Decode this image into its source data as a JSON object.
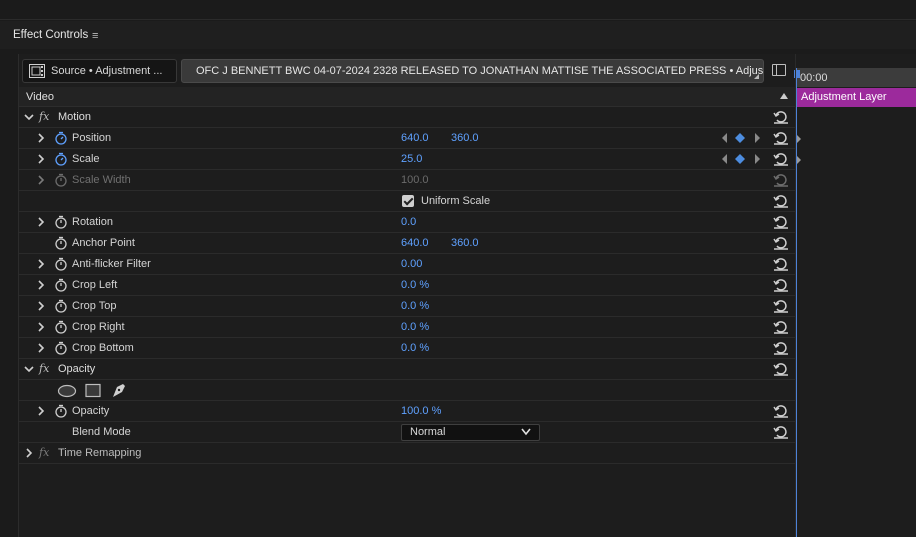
{
  "panel": {
    "title": "Effect Controls",
    "menu_glyph": "≡"
  },
  "source": {
    "label": "Source • Adjustment ...",
    "icon": "film-icon"
  },
  "sequence": {
    "label": "OFC J BENNETT BWC  04-07-2024 2328 RELEASED TO JONATHAN MATTISE THE ASSOCIATED PRESS • Adjus...",
    "icon": "sequence-icon"
  },
  "timeline": {
    "timecode": "00:00",
    "clip_label": "Adjustment Layer",
    "clip_color": "#9c2a9c",
    "playhead_color": "#4d82d8"
  },
  "video_header": "Video",
  "motion": {
    "label": "Motion",
    "fx": "fx",
    "position": {
      "label": "Position",
      "x": "640.0",
      "y": "360.0"
    },
    "scale": {
      "label": "Scale",
      "value": "25.0"
    },
    "scale_width": {
      "label": "Scale Width",
      "value": "100.0"
    },
    "uniform_scale": {
      "label": "Uniform Scale",
      "checked": true
    },
    "rotation": {
      "label": "Rotation",
      "value": "0.0"
    },
    "anchor_point": {
      "label": "Anchor Point",
      "x": "640.0",
      "y": "360.0"
    },
    "anti_flicker": {
      "label": "Anti-flicker Filter",
      "value": "0.00"
    },
    "crop_left": {
      "label": "Crop Left",
      "value": "0.0 %"
    },
    "crop_top": {
      "label": "Crop Top",
      "value": "0.0 %"
    },
    "crop_right": {
      "label": "Crop Right",
      "value": "0.0 %"
    },
    "crop_bottom": {
      "label": "Crop Bottom",
      "value": "0.0 %"
    }
  },
  "opacity": {
    "label": "Opacity",
    "fx": "fx",
    "opacity_param": {
      "label": "Opacity",
      "value": "100.0 %"
    },
    "blend_mode": {
      "label": "Blend Mode",
      "value": "Normal"
    }
  },
  "time_remapping": {
    "label": "Time Remapping",
    "fx": "fx"
  },
  "colors": {
    "value_blue": "#5fa1ff",
    "keyframe_blue": "#4d8de0"
  }
}
